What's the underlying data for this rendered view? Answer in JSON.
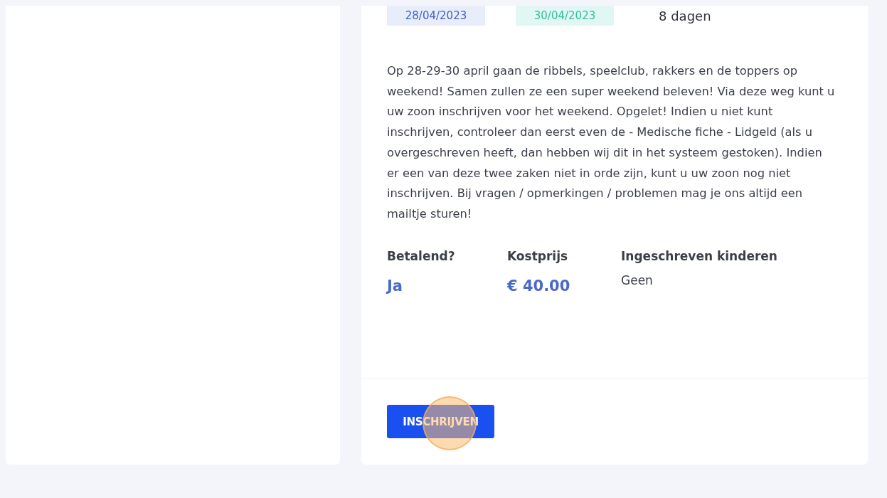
{
  "dates": [
    {
      "kind": "start",
      "text": "28/04/2023"
    },
    {
      "kind": "end",
      "text": "30/04/2023"
    },
    {
      "kind": "duration",
      "text": "8 dagen"
    }
  ],
  "description": "Op 28-29-30 april gaan de ribbels, speelclub, rakkers en de toppers op weekend! Samen zullen ze een super weekend beleven! Via deze weg kunt u uw zoon inschrijven voor het weekend. Opgelet! Indien u niet kunt inschrijven, controleer dan eerst even de - Medische fiche - Lidgeld (als u overgeschreven heeft, dan hebben wij dit in het systeem gestoken). Indien er een van deze twee zaken niet in orde zijn, kunt u uw zoon nog niet inschrijven. Bij vragen / opmerkingen / problemen mag je ons altijd een mailtje sturen!",
  "details": [
    {
      "label": "Betalend?",
      "value": "Ja",
      "kind": "highlight"
    },
    {
      "label": "Kostprijs",
      "value": "€ 40.00",
      "kind": "highlight"
    },
    {
      "label": "Ingeschreven kinderen",
      "value": "Geen",
      "kind": "plain"
    }
  ],
  "button": {
    "label": "INSCHRIJVEN"
  },
  "click_highlight": true
}
